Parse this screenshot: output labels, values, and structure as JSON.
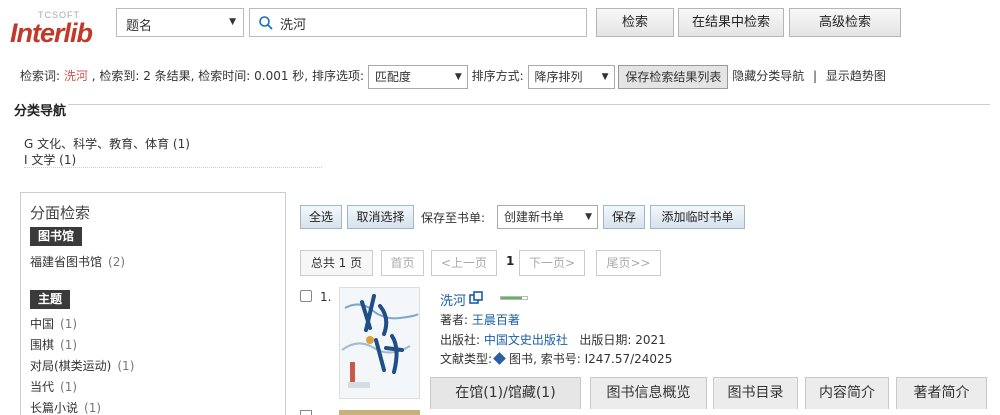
{
  "header": {
    "logo_small": "TCSOFT",
    "logo_text": "Interlib",
    "field_select": "题名",
    "search_value": "洗河",
    "btn_search": "检索",
    "btn_in_results": "在结果中检索",
    "btn_advanced": "高级检索"
  },
  "info": {
    "label_keyword": "检索词:",
    "keyword": "洗河",
    "text_found": ", 检索到: 2 条结果, 检索时间: 0.001 秒, 排序选项:",
    "sort_option": "匹配度",
    "label_sort_dir": "排序方式:",
    "sort_dir": "降序排列",
    "btn_save_list": "保存检索结果列表",
    "link_hide_nav": "隐藏分类导航",
    "sep": "|",
    "link_trend": "显示趋势图"
  },
  "category_nav": {
    "title": "分类导航",
    "items": [
      "G 文化、科学、教育、体育 (1)",
      "I 文学 (1)"
    ]
  },
  "facet": {
    "title": "分面检索",
    "library_label": "图书馆",
    "library_items": [
      {
        "name": "福建省图书馆",
        "count": "(2)"
      }
    ],
    "topic_label": "主题",
    "topic_items": [
      {
        "name": "中国",
        "count": "(1)"
      },
      {
        "name": "围棋",
        "count": "(1)"
      },
      {
        "name": "对局(棋类运动)",
        "count": "(1)"
      },
      {
        "name": "当代",
        "count": "(1)"
      },
      {
        "name": "长篇小说",
        "count": "(1)"
      }
    ]
  },
  "toolbar": {
    "select_all": "全选",
    "deselect": "取消选择",
    "save_to_label": "保存至书单:",
    "booklist_select": "创建新书单",
    "save": "保存",
    "add_temp": "添加临时书单"
  },
  "pager": {
    "total": "总共 1 页",
    "first": "首页",
    "prev": "<上一页",
    "current": "1",
    "next": "下一页>",
    "last": "尾页>>"
  },
  "result": {
    "number": "1.",
    "title": "洗河",
    "availability_fraction": 0.8,
    "author_label": "著者:",
    "author": "王晨百著",
    "publisher_label": "出版社:",
    "publisher": "中国文史出版社",
    "date_label": "出版日期:",
    "date": "2021",
    "type_label": "文献类型:",
    "type": "图书",
    "callno_label": ", 索书号:",
    "callno": "I247.57/24025",
    "tabs": [
      "在馆(1)/馆藏(1)",
      "图书信息概览",
      "图书目录",
      "内容简介",
      "著者简介"
    ]
  },
  "colors": {
    "keyword": "#d9534f",
    "link": "#1a5fa8",
    "facet_label_bg": "#3a3a3a"
  }
}
